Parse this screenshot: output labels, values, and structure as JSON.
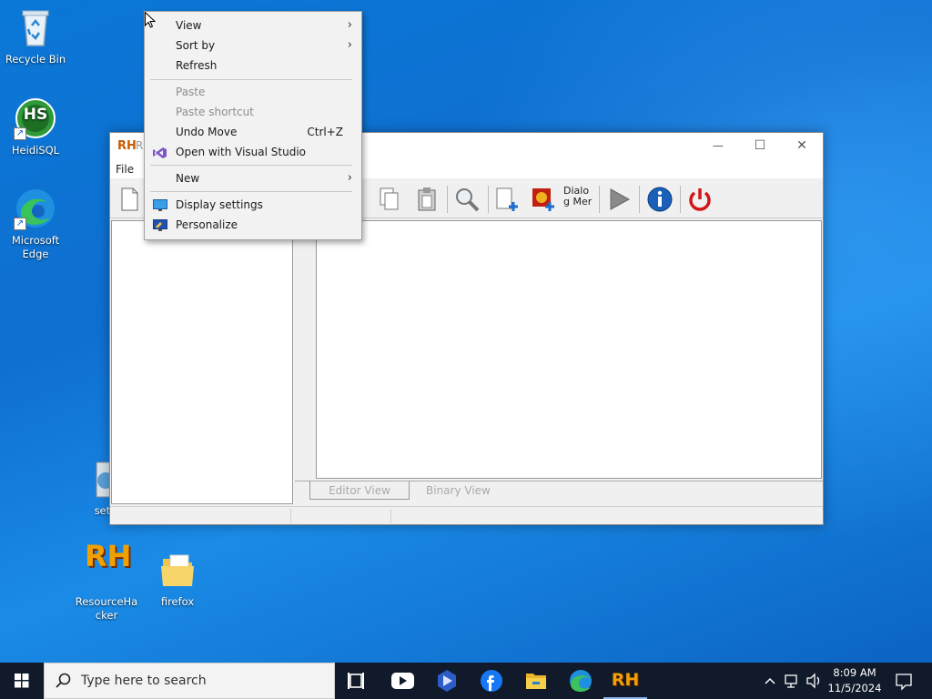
{
  "desktop": {
    "icons": [
      {
        "label": "Recycle Bin"
      },
      {
        "label": "HeidiSQL",
        "glyph": "HS"
      },
      {
        "label": "Microsoft Edge"
      },
      {
        "label": "setu"
      },
      {
        "label": "ResourceHacker",
        "glyph": "RH"
      },
      {
        "label": "firefox"
      }
    ]
  },
  "rh_window": {
    "app_glyph": "RH",
    "title": "R",
    "menu": {
      "file": "File"
    },
    "toolbar": {
      "dialog_menu_label": "Dialog Mer"
    },
    "tabs": {
      "editor": "Editor View",
      "binary": "Binary View"
    },
    "window_controls": {
      "minimize": "—",
      "maximize": "☐",
      "close": "✕"
    }
  },
  "context_menu": {
    "items": [
      {
        "label": "View",
        "submenu": true
      },
      {
        "label": "Sort by",
        "submenu": true
      },
      {
        "label": "Refresh"
      },
      {
        "label": "Paste",
        "disabled": true
      },
      {
        "label": "Paste shortcut",
        "disabled": true
      },
      {
        "label": "Undo Move",
        "accelerator": "Ctrl+Z"
      },
      {
        "label": "Open with Visual Studio"
      },
      {
        "label": "New",
        "submenu": true
      },
      {
        "label": "Display settings"
      },
      {
        "label": "Personalize"
      }
    ],
    "arrow": "›"
  },
  "taskbar": {
    "search_placeholder": "Type here to search",
    "rh_glyph": "RH",
    "clock": {
      "time": "8:09 AM",
      "date": "11/5/2024"
    }
  },
  "colors": {
    "accent": "#0078d7",
    "taskbar": "#101a2a",
    "menu_bg": "#f2f2f2"
  }
}
